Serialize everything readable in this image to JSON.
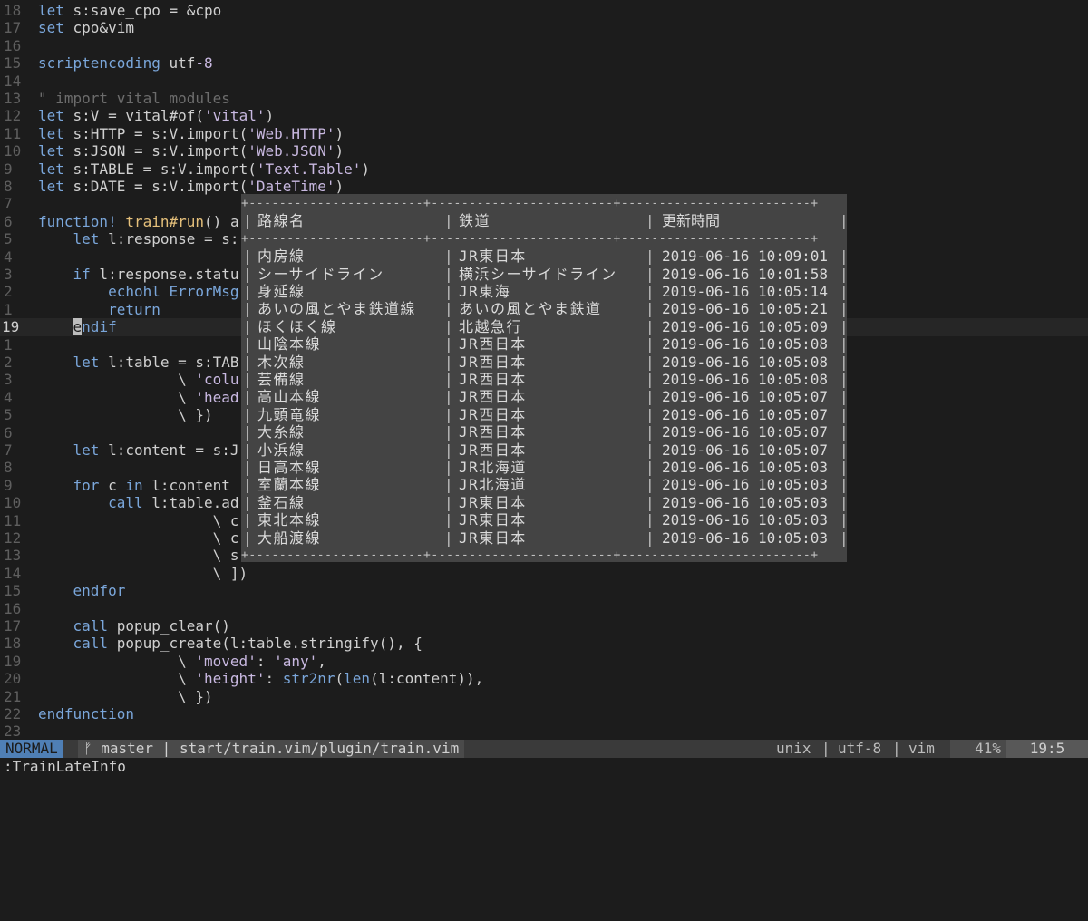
{
  "editor": {
    "lines": [
      {
        "num": "18",
        "tokens": [
          {
            "t": "let",
            "c": "kw"
          },
          {
            "t": " s:save_cpo = &cpo"
          }
        ]
      },
      {
        "num": "17",
        "tokens": [
          {
            "t": "set",
            "c": "kw"
          },
          {
            "t": " cpo&vim"
          }
        ]
      },
      {
        "num": "16",
        "tokens": []
      },
      {
        "num": "15",
        "tokens": [
          {
            "t": "scriptencoding",
            "c": "kw"
          },
          {
            "t": " utf"
          },
          {
            "t": "-8",
            "c": "str"
          }
        ]
      },
      {
        "num": "14",
        "tokens": []
      },
      {
        "num": "13",
        "tokens": [
          {
            "t": "\" import vital modules",
            "c": "cm"
          }
        ]
      },
      {
        "num": "12",
        "tokens": [
          {
            "t": "let",
            "c": "kw"
          },
          {
            "t": " s:V = vital#of("
          },
          {
            "t": "'vital'",
            "c": "str"
          },
          {
            "t": ")"
          }
        ]
      },
      {
        "num": "11",
        "tokens": [
          {
            "t": "let",
            "c": "kw"
          },
          {
            "t": " s:HTTP = s:V.import("
          },
          {
            "t": "'Web.HTTP'",
            "c": "str"
          },
          {
            "t": ")"
          }
        ]
      },
      {
        "num": "10",
        "tokens": [
          {
            "t": "let",
            "c": "kw"
          },
          {
            "t": " s:JSON = s:V.import("
          },
          {
            "t": "'Web.JSON'",
            "c": "str"
          },
          {
            "t": ")"
          }
        ]
      },
      {
        "num": "9",
        "tokens": [
          {
            "t": "let",
            "c": "kw"
          },
          {
            "t": " s:TABLE = s:V.import("
          },
          {
            "t": "'Text.Table'",
            "c": "str"
          },
          {
            "t": ")"
          }
        ]
      },
      {
        "num": "8",
        "tokens": [
          {
            "t": "let",
            "c": "kw"
          },
          {
            "t": " s:DATE = s:V.import("
          },
          {
            "t": "'DateTime'",
            "c": "str"
          },
          {
            "t": ")"
          }
        ]
      },
      {
        "num": "7",
        "tokens": []
      },
      {
        "num": "6",
        "tokens": [
          {
            "t": "function!",
            "c": "kw"
          },
          {
            "t": " "
          },
          {
            "t": "train#run",
            "c": "fn"
          },
          {
            "t": "() a"
          }
        ]
      },
      {
        "num": "5",
        "tokens": [
          {
            "t": "    "
          },
          {
            "t": "let",
            "c": "kw"
          },
          {
            "t": " l:response = s:"
          }
        ]
      },
      {
        "num": "4",
        "tokens": []
      },
      {
        "num": "3",
        "tokens": [
          {
            "t": "    "
          },
          {
            "t": "if",
            "c": "kw"
          },
          {
            "t": " l:response.statu"
          }
        ]
      },
      {
        "num": "2",
        "tokens": [
          {
            "t": "        "
          },
          {
            "t": "echohl",
            "c": "kw"
          },
          {
            "t": " "
          },
          {
            "t": "ErrorMsg",
            "c": "kw"
          }
        ]
      },
      {
        "num": "1",
        "tokens": [
          {
            "t": "        "
          },
          {
            "t": "return",
            "c": "kw"
          }
        ]
      },
      {
        "num": "19",
        "current": true,
        "tokens": [
          {
            "t": "    "
          },
          {
            "t": "e",
            "c": "cursor"
          },
          {
            "t": "ndif",
            "c": "kw"
          }
        ]
      },
      {
        "num": "1",
        "tokens": []
      },
      {
        "num": "2",
        "tokens": [
          {
            "t": "    "
          },
          {
            "t": "let",
            "c": "kw"
          },
          {
            "t": " l:table = s:TAB"
          }
        ]
      },
      {
        "num": "3",
        "tokens": [
          {
            "t": "                \\ "
          },
          {
            "t": "'colu",
            "c": "str"
          }
        ]
      },
      {
        "num": "4",
        "tokens": [
          {
            "t": "                \\ "
          },
          {
            "t": "'head",
            "c": "str"
          }
        ]
      },
      {
        "num": "5",
        "tokens": [
          {
            "t": "                \\ })"
          }
        ]
      },
      {
        "num": "6",
        "tokens": []
      },
      {
        "num": "7",
        "tokens": [
          {
            "t": "    "
          },
          {
            "t": "let",
            "c": "kw"
          },
          {
            "t": " l:content = s:J"
          }
        ]
      },
      {
        "num": "8",
        "tokens": []
      },
      {
        "num": "9",
        "tokens": [
          {
            "t": "    "
          },
          {
            "t": "for",
            "c": "kw"
          },
          {
            "t": " c "
          },
          {
            "t": "in",
            "c": "kw"
          },
          {
            "t": " l:content"
          }
        ]
      },
      {
        "num": "10",
        "tokens": [
          {
            "t": "        "
          },
          {
            "t": "call",
            "c": "kw"
          },
          {
            "t": " l:table.ad"
          }
        ]
      },
      {
        "num": "11",
        "tokens": [
          {
            "t": "                    \\ c"
          }
        ]
      },
      {
        "num": "12",
        "tokens": [
          {
            "t": "                    \\ c"
          }
        ]
      },
      {
        "num": "13",
        "tokens": [
          {
            "t": "                    \\ s"
          }
        ]
      },
      {
        "num": "14",
        "tokens": [
          {
            "t": "                    \\ ])"
          }
        ]
      },
      {
        "num": "15",
        "tokens": [
          {
            "t": "    "
          },
          {
            "t": "endfor",
            "c": "kw"
          }
        ]
      },
      {
        "num": "16",
        "tokens": []
      },
      {
        "num": "17",
        "tokens": [
          {
            "t": "    "
          },
          {
            "t": "call",
            "c": "kw"
          },
          {
            "t": " popup_clear()"
          }
        ]
      },
      {
        "num": "18",
        "tokens": [
          {
            "t": "    "
          },
          {
            "t": "call",
            "c": "kw"
          },
          {
            "t": " popup_create(l:table.stringify(), {"
          }
        ]
      },
      {
        "num": "19",
        "tokens": [
          {
            "t": "                \\ "
          },
          {
            "t": "'moved'",
            "c": "str"
          },
          {
            "t": ": "
          },
          {
            "t": "'any'",
            "c": "str"
          },
          {
            "t": ","
          }
        ]
      },
      {
        "num": "20",
        "tokens": [
          {
            "t": "                \\ "
          },
          {
            "t": "'height'",
            "c": "str"
          },
          {
            "t": ": "
          },
          {
            "t": "str2nr",
            "c": "kw"
          },
          {
            "t": "("
          },
          {
            "t": "len",
            "c": "kw"
          },
          {
            "t": "(l:content)),"
          }
        ]
      },
      {
        "num": "21",
        "tokens": [
          {
            "t": "                \\ })"
          }
        ]
      },
      {
        "num": "22",
        "tokens": [
          {
            "t": "endfunction",
            "c": "kw"
          }
        ]
      },
      {
        "num": "23",
        "tokens": []
      }
    ]
  },
  "popup": {
    "separator": "+-----------------------+------------------------+-------------------------+",
    "headers": [
      "路線名",
      "鉄道",
      "更新時間"
    ],
    "rows": [
      [
        "内房線",
        "JR東日本",
        "2019-06-16 10:09:01"
      ],
      [
        "シーサイドライン",
        "横浜シーサイドライン",
        "2019-06-16 10:01:58"
      ],
      [
        "身延線",
        "JR東海",
        "2019-06-16 10:05:14"
      ],
      [
        "あいの風とやま鉄道線",
        "あいの風とやま鉄道",
        "2019-06-16 10:05:21"
      ],
      [
        "ほくほく線",
        "北越急行",
        "2019-06-16 10:05:09"
      ],
      [
        "山陰本線",
        "JR西日本",
        "2019-06-16 10:05:08"
      ],
      [
        "木次線",
        "JR西日本",
        "2019-06-16 10:05:08"
      ],
      [
        "芸備線",
        "JR西日本",
        "2019-06-16 10:05:08"
      ],
      [
        "高山本線",
        "JR西日本",
        "2019-06-16 10:05:07"
      ],
      [
        "九頭竜線",
        "JR西日本",
        "2019-06-16 10:05:07"
      ],
      [
        "大糸線",
        "JR西日本",
        "2019-06-16 10:05:07"
      ],
      [
        "小浜線",
        "JR西日本",
        "2019-06-16 10:05:07"
      ],
      [
        "日高本線",
        "JR北海道",
        "2019-06-16 10:05:03"
      ],
      [
        "室蘭本線",
        "JR北海道",
        "2019-06-16 10:05:03"
      ],
      [
        "釜石線",
        "JR東日本",
        "2019-06-16 10:05:03"
      ],
      [
        "東北本線",
        "JR東日本",
        "2019-06-16 10:05:03"
      ],
      [
        "大船渡線",
        "JR東日本",
        "2019-06-16 10:05:03"
      ]
    ]
  },
  "statusline": {
    "mode": "NORMAL",
    "branch_icon": "ᚠ",
    "branch": "master",
    "file": "start/train.vim/plugin/train.vim",
    "fileformat": "unix",
    "encoding": "utf-8",
    "filetype": "vim",
    "percent": "41%",
    "position": "19:5"
  },
  "cmdline": {
    "text": ":TrainLateInfo"
  },
  "colors": {
    "background": "#1c1c1c",
    "mode_bg": "#4f7fb5",
    "popup_bg": "#444444",
    "keyword": "#7aa6da",
    "string": "#c8b8e0"
  }
}
